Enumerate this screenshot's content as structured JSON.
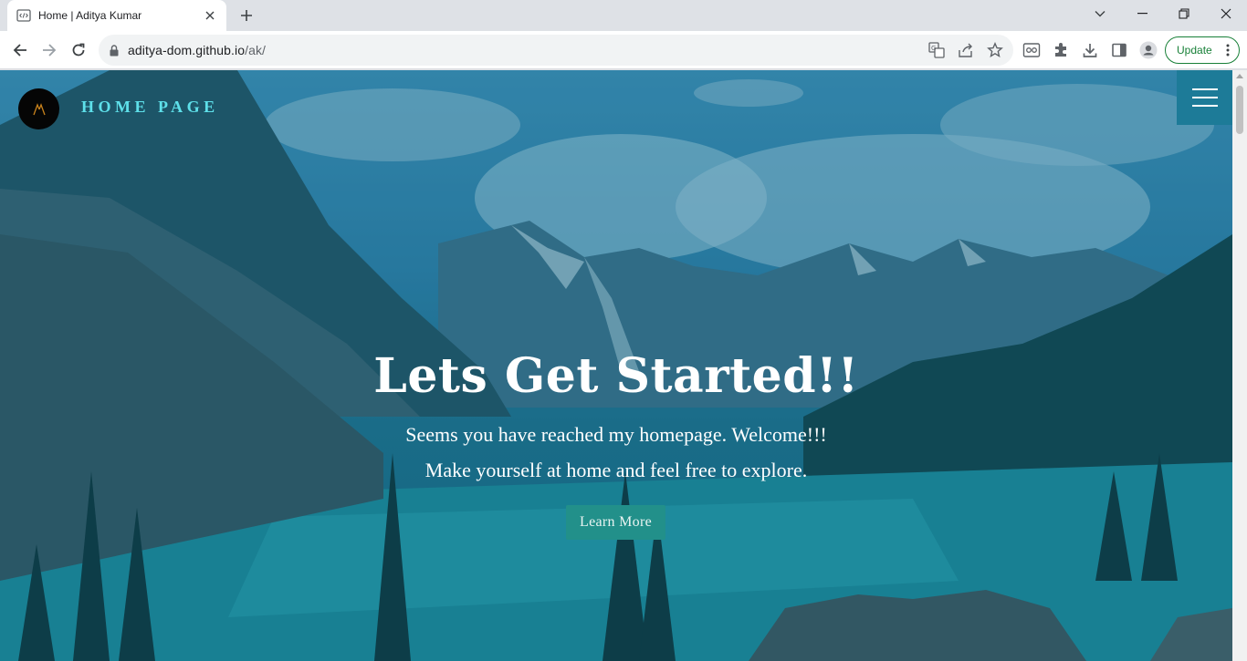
{
  "browser": {
    "tab_title": "Home | Aditya Kumar",
    "url_host": "aditya-dom.github.io",
    "url_path": "/ak/",
    "update_label": "Update",
    "icons": [
      "code-favicon",
      "close-icon",
      "plus-icon",
      "chevron-down-icon",
      "minimize-icon",
      "restore-icon",
      "window-close-icon",
      "back-arrow-icon",
      "forward-arrow-icon",
      "reload-icon",
      "lock-icon",
      "translate-icon",
      "share-icon",
      "star-icon",
      "reading-list-icon",
      "extensions-icon",
      "download-icon",
      "side-panel-icon",
      "profile-icon",
      "more-vert-icon"
    ]
  },
  "site": {
    "title": "HOME PAGE",
    "headline": "Lets Get Started!!",
    "subtitle_1": "Seems you have reached my homepage. Welcome!!!",
    "subtitle_2": "Make yourself at home and feel free to explore.",
    "cta_label": "Learn More"
  },
  "colors": {
    "accent_title": "#5ee0ea",
    "menu_bg": "#1d7b98",
    "cta_bg": "#22908a",
    "update_green": "#188038"
  }
}
